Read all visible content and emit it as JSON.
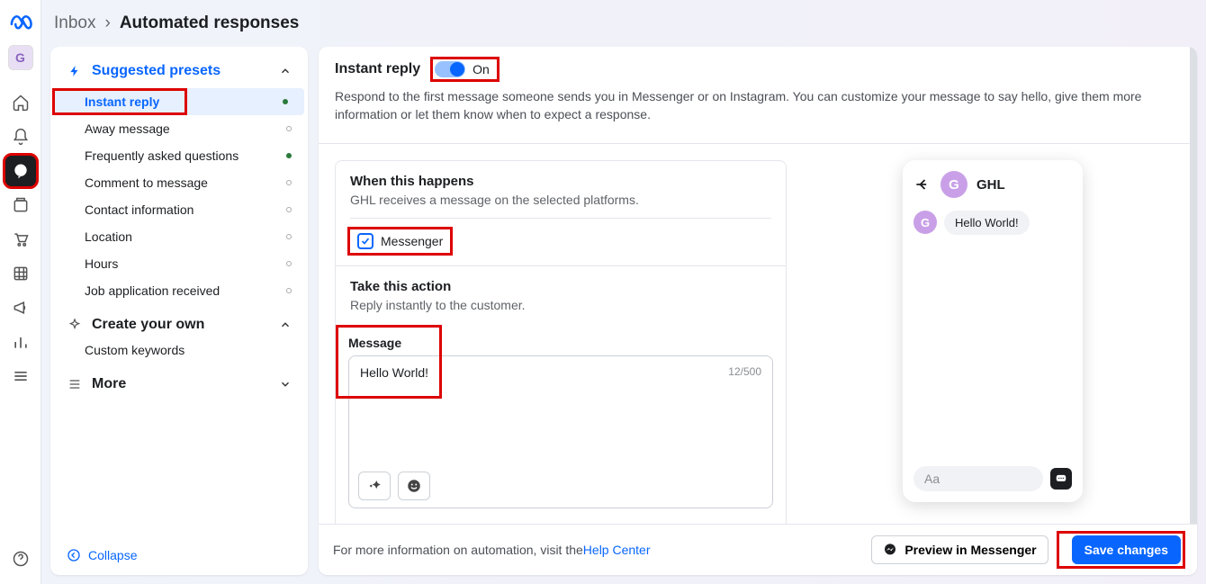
{
  "rail": {
    "avatar_initial": "G"
  },
  "breadcrumb": {
    "parent": "Inbox",
    "sep": "›",
    "current": "Automated responses"
  },
  "sidebar": {
    "suggested_header": "Suggested presets",
    "presets": [
      {
        "label": "Instant reply",
        "status": "solid"
      },
      {
        "label": "Away message",
        "status": "hollow"
      },
      {
        "label": "Frequently asked questions",
        "status": "solid"
      },
      {
        "label": "Comment to message",
        "status": "hollow"
      },
      {
        "label": "Contact information",
        "status": "hollow"
      },
      {
        "label": "Location",
        "status": "hollow"
      },
      {
        "label": "Hours",
        "status": "hollow"
      },
      {
        "label": "Job application received",
        "status": "hollow"
      }
    ],
    "create_header": "Create your own",
    "create_items": [
      {
        "label": "Custom keywords"
      }
    ],
    "more_header": "More",
    "collapse": "Collapse"
  },
  "content": {
    "title": "Instant reply",
    "toggle_label": "On",
    "description": "Respond to the first message someone sends you in Messenger or on Instagram. You can customize your message to say hello, give them more information or let them know when to expect a response.",
    "when_title": "When this happens",
    "when_sub": "GHL receives a message on the selected platforms.",
    "platform_label": "Messenger",
    "action_title": "Take this action",
    "action_sub": "Reply instantly to the customer.",
    "message_label": "Message",
    "message_text": "Hello World!",
    "message_count": "12/500"
  },
  "preview": {
    "name": "GHL",
    "avatar_initial": "G",
    "bubble": "Hello World!",
    "input_placeholder": "Aa"
  },
  "footer": {
    "info_prefix": "For more information on automation, visit the ",
    "info_link": "Help Center",
    "preview_btn": "Preview in Messenger",
    "save_btn": "Save changes"
  }
}
